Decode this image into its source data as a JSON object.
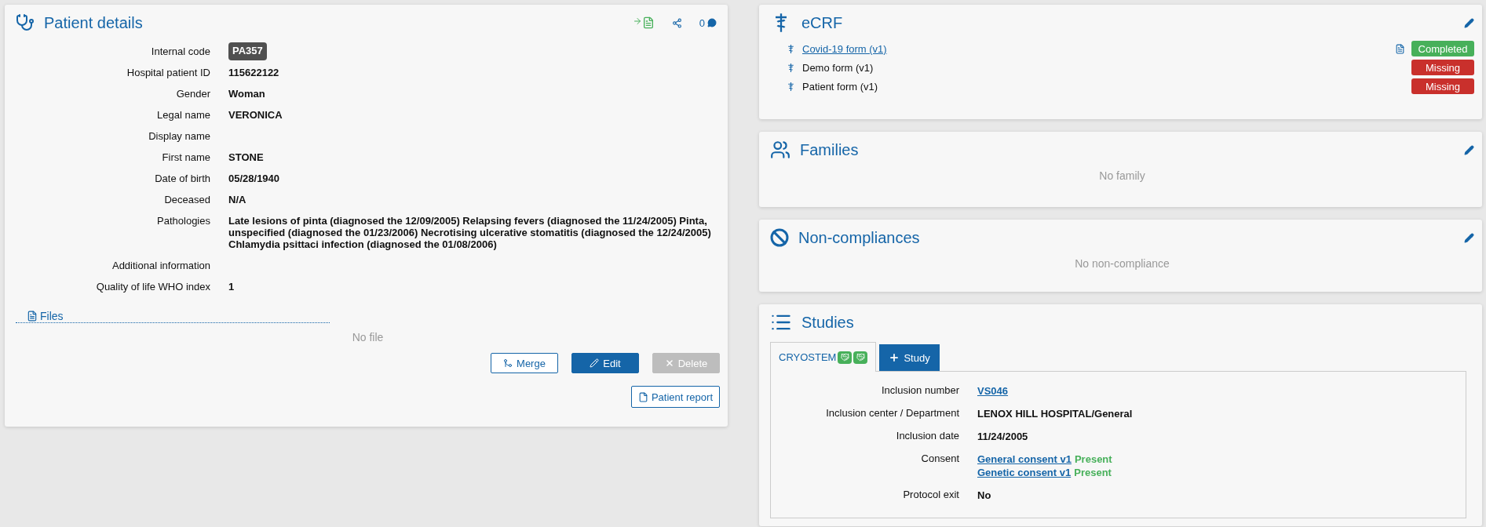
{
  "patient_details": {
    "title": "Patient details",
    "comment_count": "0",
    "fields": [
      {
        "label": "Internal code",
        "value": "PA357",
        "kind": "badge"
      },
      {
        "label": "Hospital patient ID",
        "value": "115622122",
        "kind": "text"
      },
      {
        "label": "Gender",
        "value": "Woman",
        "kind": "text"
      },
      {
        "label": "Legal name",
        "value": "VERONICA",
        "kind": "text"
      },
      {
        "label": "Display name",
        "kind": "text"
      },
      {
        "label": "First name",
        "value": "STONE",
        "kind": "text"
      },
      {
        "label": "Date of birth",
        "value": "05/28/1940",
        "kind": "text"
      },
      {
        "label": "Deceased",
        "value": "N/A",
        "kind": "text"
      },
      {
        "label": "Pathologies",
        "value": "Late lesions of pinta (diagnosed the 12/09/2005) Relapsing fevers (diagnosed the 11/24/2005) Pinta, unspecified (diagnosed the 01/23/2006) Necrotising ulcerative stomatitis (diagnosed the 12/24/2005) Chlamydia psittaci infection (diagnosed the 01/08/2006)",
        "kind": "text"
      },
      {
        "label": "Additional information",
        "kind": "text"
      },
      {
        "label": "Quality of life WHO index",
        "value": "1",
        "kind": "text"
      }
    ],
    "files": {
      "title": "Files",
      "empty": "No file"
    },
    "buttons": [
      {
        "label": "Merge",
        "kind": "outline",
        "disabled": false
      },
      {
        "label": "Edit",
        "kind": "primary",
        "disabled": false
      },
      {
        "label": "Delete",
        "kind": "danger",
        "disabled": true
      }
    ],
    "report_button": "Patient report"
  },
  "ecrf": {
    "title": "eCRF",
    "forms": [
      {
        "name": "Covid-19 form (v1)",
        "link": true,
        "pdf": true,
        "status": "Completed",
        "color": "#47b05a"
      },
      {
        "name": "Demo form (v1)",
        "link": false,
        "pdf": false,
        "status": "Missing",
        "color": "#c9302c"
      },
      {
        "name": "Patient form (v1)",
        "link": false,
        "pdf": false,
        "status": "Missing",
        "color": "#c9302c"
      }
    ]
  },
  "families": {
    "title": "Families",
    "empty": "No family"
  },
  "noncompliances": {
    "title": "Non-compliances",
    "empty": "No non-compliance"
  },
  "studies": {
    "title": "Studies",
    "tabs": [
      {
        "label": "CRYOSTEM",
        "selected": true
      }
    ],
    "add_button": "Study",
    "fields": [
      {
        "label": "Inclusion number",
        "values": [
          {
            "text": "VS046",
            "kind": "link"
          }
        ]
      },
      {
        "label": "Inclusion center / Department",
        "values": [
          {
            "text": "LENOX HILL HOSPITAL/General",
            "kind": "text"
          }
        ]
      },
      {
        "label": "Inclusion date",
        "values": [
          {
            "text": "11/24/2005",
            "kind": "text"
          }
        ]
      },
      {
        "label": "Consent",
        "values": [
          {
            "text": "General consent v1",
            "kind": "link",
            "status": "Present"
          },
          {
            "text": "Genetic consent v1",
            "kind": "link",
            "status": "Present"
          }
        ]
      },
      {
        "label": "Protocol exit",
        "values": [
          {
            "text": "No",
            "kind": "text"
          }
        ]
      }
    ]
  }
}
